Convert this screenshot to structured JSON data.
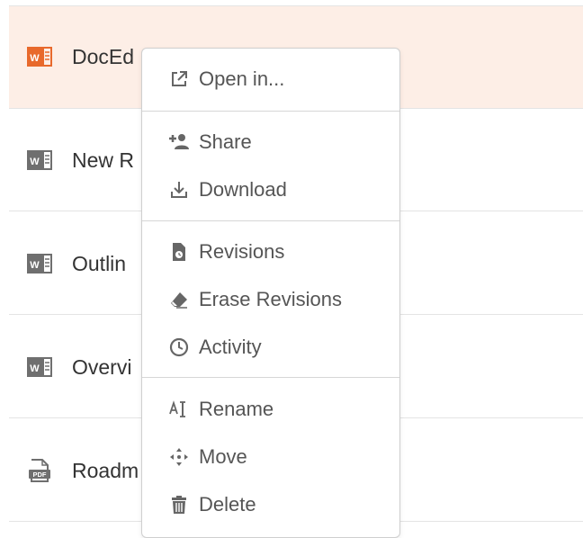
{
  "files": [
    {
      "name": "DocEd",
      "type": "word",
      "selected": true
    },
    {
      "name": "New R",
      "type": "word",
      "selected": false
    },
    {
      "name": "Outlin",
      "type": "word",
      "selected": false
    },
    {
      "name": "Overvi",
      "type": "word",
      "selected": false
    },
    {
      "name": "Roadm",
      "type": "pdf",
      "selected": false
    }
  ],
  "context_menu": {
    "items": [
      {
        "label": "Open in...",
        "icon": "external-link-icon"
      },
      {
        "label": "Share",
        "icon": "add-user-icon"
      },
      {
        "label": "Download",
        "icon": "download-icon"
      },
      {
        "label": "Revisions",
        "icon": "file-history-icon"
      },
      {
        "label": "Erase Revisions",
        "icon": "eraser-icon"
      },
      {
        "label": "Activity",
        "icon": "clock-icon"
      },
      {
        "label": "Rename",
        "icon": "text-cursor-icon"
      },
      {
        "label": "Move",
        "icon": "move-arrows-icon"
      },
      {
        "label": "Delete",
        "icon": "trash-icon"
      }
    ]
  },
  "colors": {
    "selected_row": "#fdeee6",
    "word_icon_selected": "#e8692c",
    "word_icon": "#6f6f6f",
    "menu_text": "#555555"
  }
}
